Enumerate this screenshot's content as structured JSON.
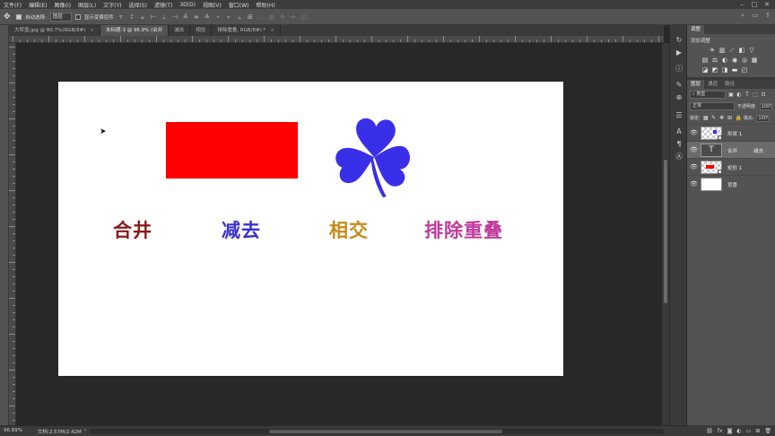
{
  "menu": [
    "文件(F)",
    "编辑(E)",
    "图像(I)",
    "图层(L)",
    "文字(Y)",
    "选择(S)",
    "滤镜(T)",
    "3D(D)",
    "视图(V)",
    "窗口(W)",
    "帮助(H)"
  ],
  "options": {
    "auto_select_label": "自动选择:",
    "auto_select_value": "图层",
    "show_transform_label": "显示变换控件"
  },
  "tabs": [
    {
      "label": "大转盘.jpg @ 80.7%(RGB/8#)",
      "active": false
    },
    {
      "label": "未标题-3 @ 96.9% (合并",
      "active": true
    },
    {
      "label": "减去",
      "active": false
    },
    {
      "label": "相交",
      "active": false
    },
    {
      "label": "排除重叠, RGB/8#) *",
      "active": false
    }
  ],
  "canvas": {
    "labels": [
      {
        "text": "合井",
        "color": "#8b1a1a"
      },
      {
        "text": "减去",
        "color": "#3a2fd0"
      },
      {
        "text": "相交",
        "color": "#c78a17"
      },
      {
        "text": "排除重叠",
        "color": "#c0399c"
      }
    ],
    "rect_color": "#ff0000",
    "clover_color": "#3a2fe8"
  },
  "status": {
    "zoom": "96.89%",
    "doc_info": "文档:2.57M/2.42M"
  },
  "adjustments": {
    "tab": "调整",
    "title": "添加调整"
  },
  "layers_panel": {
    "tabs": [
      "图层",
      "通道",
      "路径"
    ],
    "kind_label": "类型",
    "blend_mode": "正常",
    "opacity_label": "不透明度:",
    "opacity_value": "100%",
    "lock_label": "锁定:",
    "fill_label": "填充:",
    "fill_value": "100%",
    "layers": [
      {
        "name": "形状 1",
        "extra": "",
        "thumb": "shape-blue",
        "selected": false
      },
      {
        "name": "合井",
        "extra": "减去",
        "thumb": "text",
        "selected": true
      },
      {
        "name": "矩形 1",
        "extra": "",
        "thumb": "shape-red",
        "selected": false
      },
      {
        "name": "背景",
        "extra": "",
        "thumb": "white",
        "selected": false
      }
    ]
  }
}
